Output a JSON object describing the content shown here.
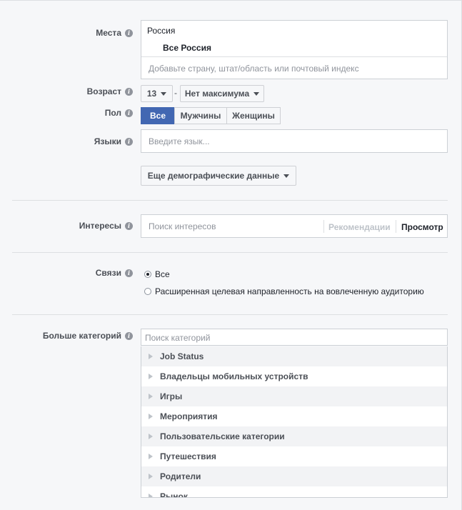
{
  "places": {
    "label": "Места",
    "country": "Россия",
    "selected": "Все Россия",
    "placeholder": "Добавьте страну, штат/область или почтовый индекс"
  },
  "age": {
    "label": "Возраст",
    "min": "13",
    "separator": "-",
    "max": "Нет максимума"
  },
  "gender": {
    "label": "Пол",
    "options": [
      "Все",
      "Мужчины",
      "Женщины"
    ],
    "selected": "Все"
  },
  "languages": {
    "label": "Языки",
    "placeholder": "Введите язык..."
  },
  "more_demographics_label": "Еще демографические данные",
  "interests": {
    "label": "Интересы",
    "placeholder": "Поиск интересов",
    "recommendations": "Рекомендации",
    "browse": "Просмотр"
  },
  "connections": {
    "label": "Связи",
    "options": [
      "Все",
      "Расширенная целевая направленность на вовлеченную аудиторию"
    ],
    "selected": "Все"
  },
  "more_categories": {
    "label": "Больше категорий",
    "placeholder": "Поиск категорий",
    "items": [
      "Job Status",
      "Владельцы мобильных устройств",
      "Игры",
      "Мероприятия",
      "Пользовательские категории",
      "Путешествия",
      "Родители",
      "Рынок"
    ]
  },
  "colors": {
    "accent": "#4267b2",
    "background": "#f6f7f9"
  },
  "icons": {
    "info": "info-icon",
    "dropdown": "caret-down-icon",
    "expand": "expand-triangle-icon"
  }
}
